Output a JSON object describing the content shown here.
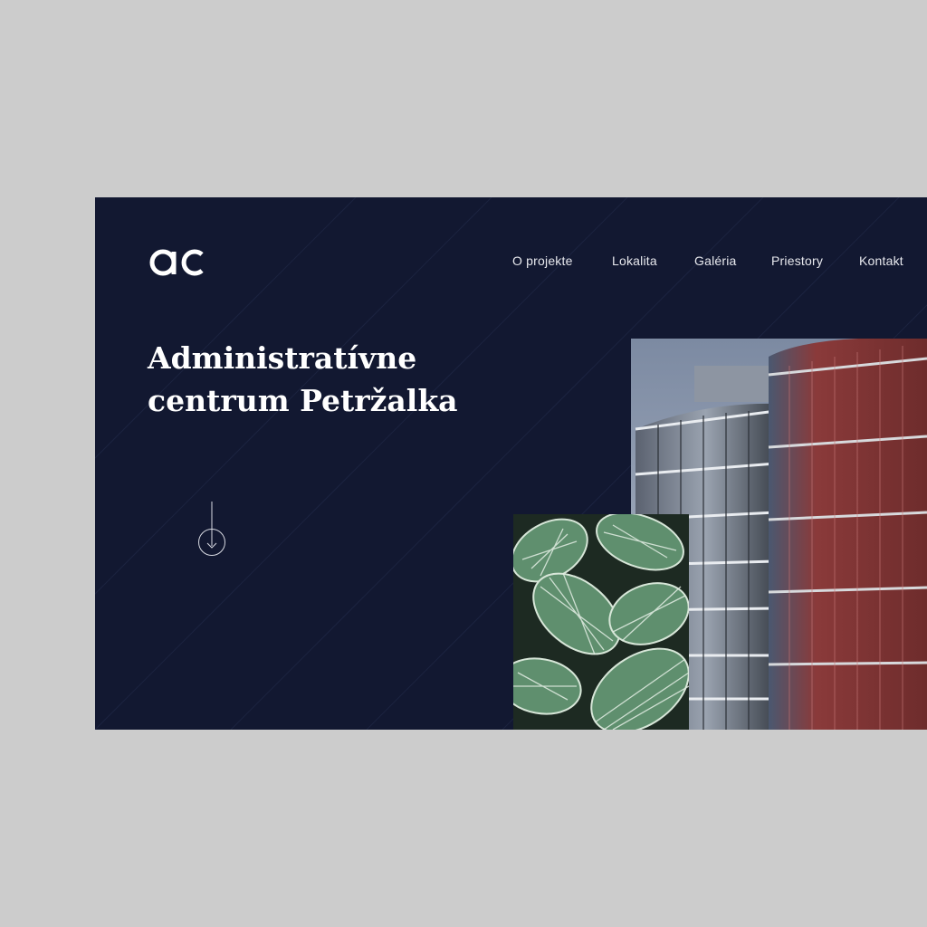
{
  "brand": {
    "logo_text": "ac"
  },
  "nav": {
    "items": [
      {
        "label": "O projekte"
      },
      {
        "label": "Lokalita"
      },
      {
        "label": "Galéria"
      },
      {
        "label": "Priestory"
      },
      {
        "label": "Kontakt"
      }
    ]
  },
  "hero": {
    "title_line1": "Administratívne",
    "title_line2": "centrum Petržalka",
    "scroll_icon": "arrow-down-circle-icon"
  },
  "images": {
    "building": "office-building-photo",
    "plants": "calathea-leaves-photo"
  },
  "colors": {
    "background": "#121831",
    "page": "#cccccc",
    "text": "#ffffff"
  }
}
